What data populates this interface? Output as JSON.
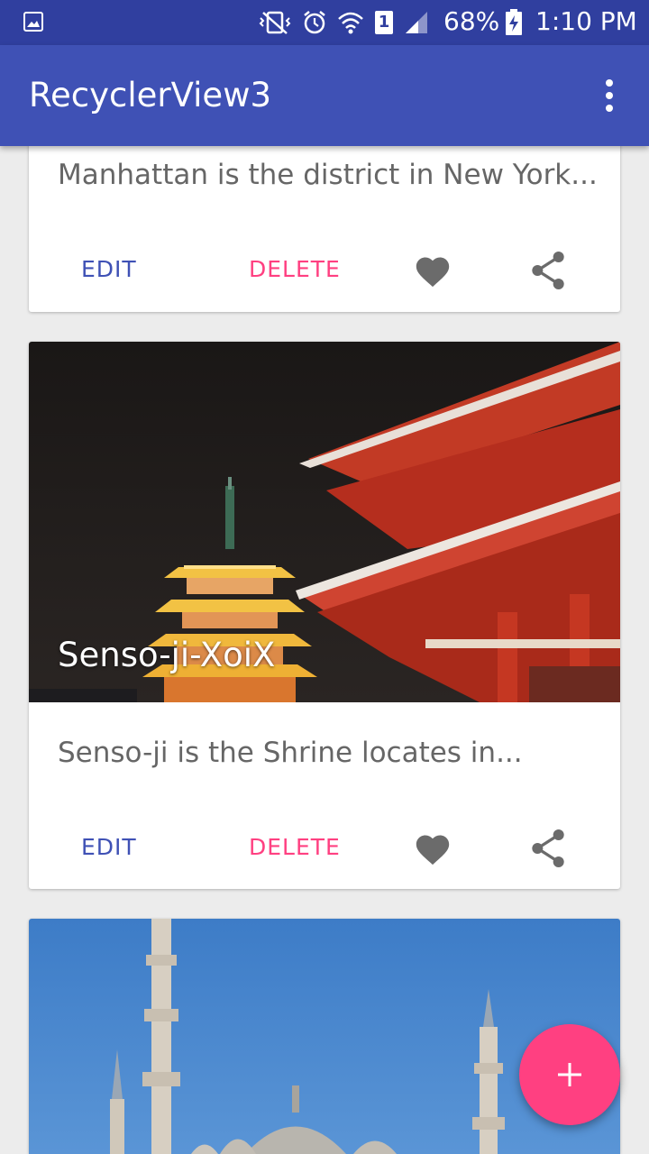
{
  "status_bar": {
    "battery_percent": "68%",
    "time": "1:10 PM",
    "sim_slot": "1",
    "icons": [
      "image-icon",
      "vibrate-mute-icon",
      "alarm-icon",
      "wifi-icon",
      "sim-icon",
      "signal-icon",
      "battery-charging-icon"
    ]
  },
  "app_bar": {
    "title": "RecyclerView3",
    "overflow_icon": "more-vert-icon"
  },
  "cards": [
    {
      "description": "Manhattan is the district in New York...",
      "edit_label": "EDIT",
      "delete_label": "DELETE"
    },
    {
      "photo_caption": "Senso-ji-XoiX",
      "description": "Senso-ji is the Shrine locates in...",
      "edit_label": "EDIT",
      "delete_label": "DELETE"
    },
    {
      "photo": "mosque-photo"
    }
  ],
  "fab": {
    "icon": "add-icon"
  },
  "colors": {
    "primary": "#3f51b5",
    "primary_dark": "#303f9f",
    "accent": "#ff4081",
    "action_icon": "#6b6b6b"
  }
}
